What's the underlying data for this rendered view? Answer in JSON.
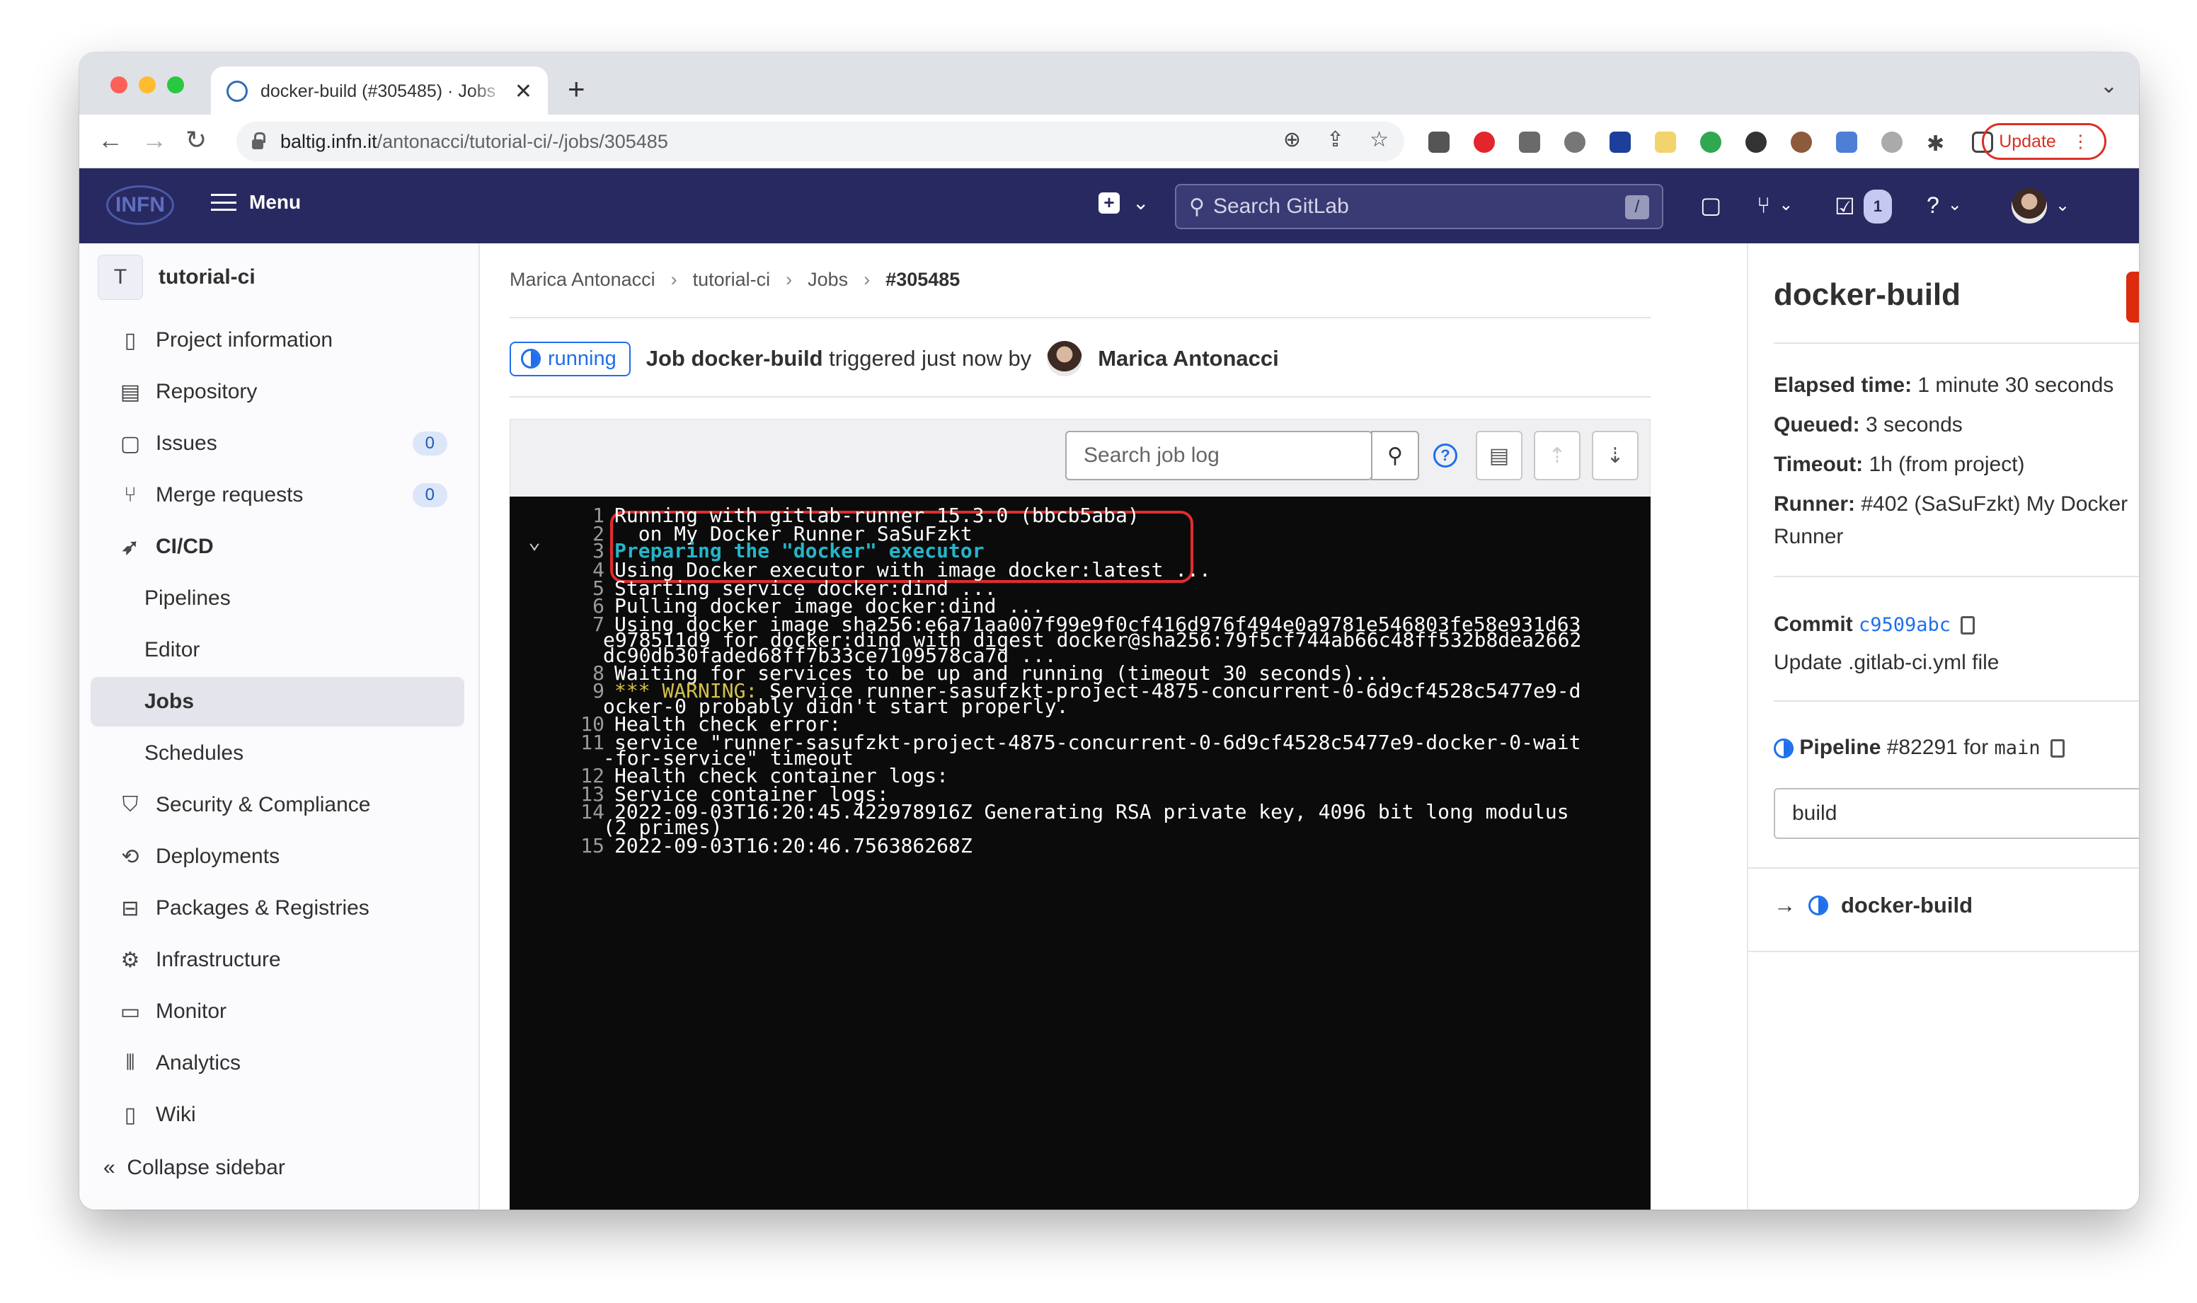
{
  "browser": {
    "tab_title": "docker-build (#305485) · Jobs",
    "url_host": "baltig.infn.it",
    "url_path": "/antonacci/tutorial-ci/-/jobs/305485",
    "update_label": "Update"
  },
  "header": {
    "logo_text": "INFN",
    "menu_label": "Menu",
    "search_placeholder": "Search GitLab",
    "search_shortcut": "/",
    "todo_count": "1"
  },
  "sidebar": {
    "project_initial": "T",
    "project_name": "tutorial-ci",
    "items": [
      {
        "label": "Project information",
        "icon": "document-icon"
      },
      {
        "label": "Repository",
        "icon": "book-icon"
      },
      {
        "label": "Issues",
        "icon": "issues-icon",
        "count": "0"
      },
      {
        "label": "Merge requests",
        "icon": "merge-icon",
        "count": "0"
      },
      {
        "label": "CI/CD",
        "icon": "rocket-icon"
      },
      {
        "label": "Pipelines"
      },
      {
        "label": "Editor"
      },
      {
        "label": "Jobs",
        "active": true
      },
      {
        "label": "Schedules"
      },
      {
        "label": "Security & Compliance",
        "icon": "shield-icon"
      },
      {
        "label": "Deployments",
        "icon": "deploy-icon"
      },
      {
        "label": "Packages & Registries",
        "icon": "package-icon"
      },
      {
        "label": "Infrastructure",
        "icon": "cloud-gear-icon"
      },
      {
        "label": "Monitor",
        "icon": "monitor-icon"
      },
      {
        "label": "Analytics",
        "icon": "chart-icon"
      },
      {
        "label": "Wiki",
        "icon": "book-icon"
      }
    ],
    "collapse_label": "Collapse sidebar"
  },
  "breadcrumb": [
    "Marica Antonacci",
    "tutorial-ci",
    "Jobs",
    "#305485"
  ],
  "job": {
    "status": "running",
    "prefix": "Job",
    "name": "docker-build",
    "triggered_text": "triggered just now by",
    "user": "Marica Antonacci"
  },
  "log_toolbar": {
    "search_placeholder": "Search job log"
  },
  "log_lines": [
    {
      "n": "1",
      "t": "Running with gitlab-runner 15.3.0 (bbcb5aba)"
    },
    {
      "n": "2",
      "t": "  on My Docker Runner SaSuFzkt"
    },
    {
      "n": "3",
      "t": "Preparing the \"docker\" executor"
    },
    {
      "n": "4",
      "t": "Using Docker executor with image docker:latest ..."
    },
    {
      "n": "5",
      "t": "Starting service docker:dind ..."
    },
    {
      "n": "6",
      "t": "Pulling docker image docker:dind ..."
    },
    {
      "n": "7",
      "t": "Using docker image sha256:e6a71aa007f99e9f0cf416d976f494e0a9781e546803fe58e931d63",
      "c1": "e978511d9 for docker:dind with digest docker@sha256:79f5cf744ab66c48ff532b8dea2662",
      "c2": "dc90db30faded68ff7b33ce7109578ca7d ..."
    },
    {
      "n": "8",
      "t": "Waiting for services to be up and running (timeout 30 seconds)..."
    },
    {
      "n": "9",
      "w": "*** WARNING:",
      "t": " Service runner-sasufzkt-project-4875-concurrent-0-6d9cf4528c5477e9-d",
      "c1": "ocker-0 probably didn't start properly."
    },
    {
      "n": "10",
      "t": "Health check error:"
    },
    {
      "n": "11",
      "t": "service \"runner-sasufzkt-project-4875-concurrent-0-6d9cf4528c5477e9-docker-0-wait",
      "c1": "-for-service\" timeout"
    },
    {
      "n": "12",
      "t": "Health check container logs:"
    },
    {
      "n": "13",
      "t": "Service container logs:"
    },
    {
      "n": "14",
      "t": "2022-09-03T16:20:45.422978916Z Generating RSA private key, 4096 bit long modulus",
      "c1": "(2 primes)"
    },
    {
      "n": "15",
      "t": "2022-09-03T16:20:46.756386268Z"
    }
  ],
  "details": {
    "title": "docker-build",
    "elapsed_label": "Elapsed time:",
    "elapsed_value": "1 minute 30 seconds",
    "queued_label": "Queued:",
    "queued_value": "3 seconds",
    "timeout_label": "Timeout:",
    "timeout_value": "1h (from project)",
    "runner_label": "Runner:",
    "runner_value": "#402 (SaSuFzkt) My Docker",
    "runner_value2": "Runner",
    "commit_label": "Commit",
    "commit_sha": "c9509abc",
    "commit_message": "Update .gitlab-ci.yml file",
    "pipeline_label": "Pipeline",
    "pipeline_id": "#82291",
    "pipeline_for": "for",
    "branch": "main",
    "stage_selected": "build",
    "current_job": "docker-build"
  },
  "colors": {
    "header_bg": "#292961",
    "running_blue": "#1f6feb",
    "cancel_red": "#dd2b0e",
    "highlight_red": "#e02d2d",
    "log_bg": "#0b0b0b"
  }
}
